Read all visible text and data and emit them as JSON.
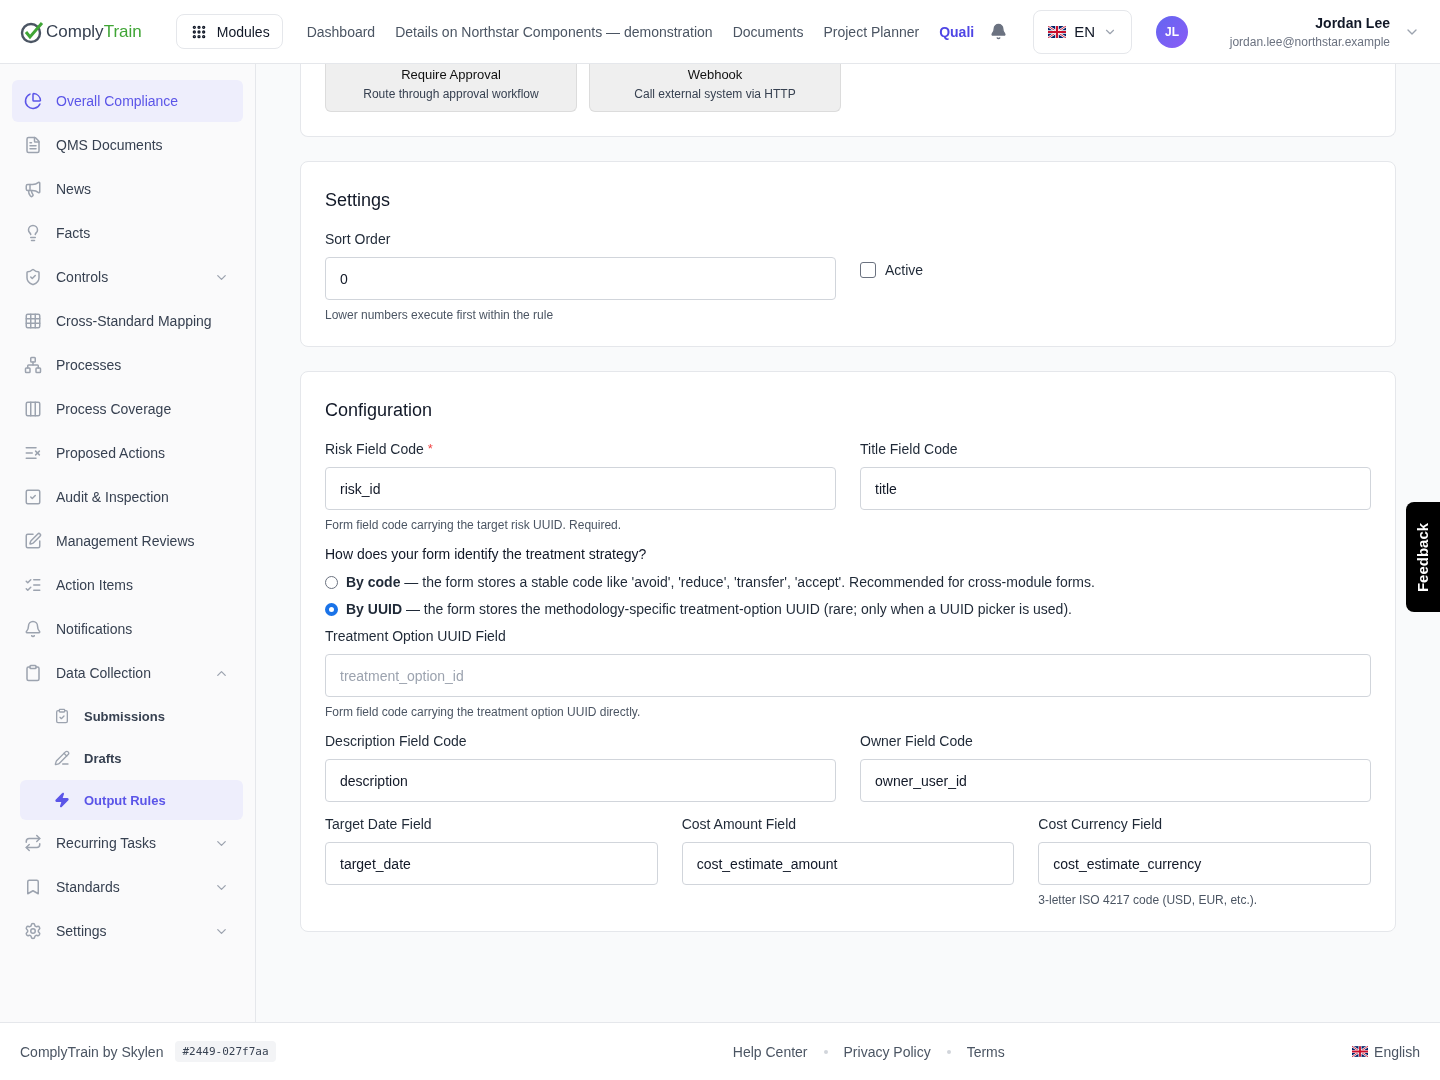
{
  "header": {
    "logo": {
      "first": "Comply",
      "second": "Train"
    },
    "modules_button": "Modules",
    "nav": [
      {
        "label": "Dashboard",
        "selected": false
      },
      {
        "label": "Details on Northstar Components — demonstration",
        "selected": false
      },
      {
        "label": "Documents",
        "selected": false
      },
      {
        "label": "Project Planner",
        "selected": false
      },
      {
        "label": "Quali",
        "selected": true
      }
    ],
    "language": "EN",
    "user": {
      "initials": "JL",
      "name": "Jordan Lee",
      "email": "jordan.lee@northstar.example"
    }
  },
  "sidebar": {
    "items": [
      {
        "label": "Overall Compliance",
        "selected": true
      },
      {
        "label": "QMS Documents",
        "selected": false
      },
      {
        "label": "News",
        "selected": false
      },
      {
        "label": "Facts",
        "selected": false
      },
      {
        "label": "Controls",
        "selected": false,
        "expanded": false
      },
      {
        "label": "Cross-Standard Mapping",
        "selected": false
      },
      {
        "label": "Processes",
        "selected": false
      },
      {
        "label": "Process Coverage",
        "selected": false
      },
      {
        "label": "Proposed Actions",
        "selected": false
      },
      {
        "label": "Audit & Inspection",
        "selected": false
      },
      {
        "label": "Management Reviews",
        "selected": false
      },
      {
        "label": "Action Items",
        "selected": false
      },
      {
        "label": "Notifications",
        "selected": false
      },
      {
        "label": "Data Collection",
        "selected": false,
        "expanded": true,
        "children": [
          {
            "label": "Submissions",
            "selected": false
          },
          {
            "label": "Drafts",
            "selected": false
          },
          {
            "label": "Output Rules",
            "selected": true
          }
        ]
      },
      {
        "label": "Recurring Tasks",
        "selected": false,
        "expanded": false
      },
      {
        "label": "Standards",
        "selected": false,
        "expanded": false
      },
      {
        "label": "Settings",
        "selected": false,
        "expanded": false
      }
    ]
  },
  "action_cards": [
    {
      "title": "Require Approval",
      "description": "Route through approval workflow"
    },
    {
      "title": "Webhook",
      "description": "Call external system via HTTP"
    }
  ],
  "settings": {
    "title": "Settings",
    "sort_order": {
      "label": "Sort Order",
      "value": "0",
      "hint": "Lower numbers execute first within the rule"
    },
    "active": {
      "label": "Active",
      "checked": false
    }
  },
  "configuration": {
    "title": "Configuration",
    "row_1": [
      {
        "label": "Risk Field Code",
        "required_mark": "*",
        "value": "risk_id",
        "hint": "Form field code carrying the target risk UUID. Required."
      },
      {
        "label": "Title Field Code",
        "value": "title"
      }
    ],
    "question": "How does your form identify the treatment strategy?",
    "options": [
      {
        "text": "**By code** — the form stores a stable code like 'avoid', 'reduce', 'transfer', 'accept'. Recommended for cross-module forms.",
        "selected": false
      },
      {
        "text": "**By UUID** — the form stores the methodology-specific treatment-option UUID (rare; only when a UUID picker is used).",
        "selected": true
      }
    ],
    "treatment_field": {
      "label": "Treatment Option UUID Field",
      "placeholder": "treatment_option_id",
      "hint": "Form field code carrying the treatment option UUID directly."
    },
    "row_2": [
      {
        "label": "Description Field Code",
        "value": "description"
      },
      {
        "label": "Owner Field Code",
        "value": "owner_user_id"
      }
    ],
    "row_3": [
      {
        "label": "Target Date Field",
        "value": "target_date"
      },
      {
        "label": "Cost Amount Field",
        "value": "cost_estimate_amount"
      },
      {
        "label": "Cost Currency Field",
        "value": "cost_estimate_currency",
        "hint": "3-letter ISO 4217 code (USD, EUR, etc.)."
      }
    ]
  },
  "feedback": "Feedback",
  "footer": {
    "brand": "ComplyTrain by Skylen",
    "version": "#2449-027f7aa",
    "links": [
      "Help Center",
      "Privacy Policy",
      "Terms"
    ],
    "language": "English"
  }
}
